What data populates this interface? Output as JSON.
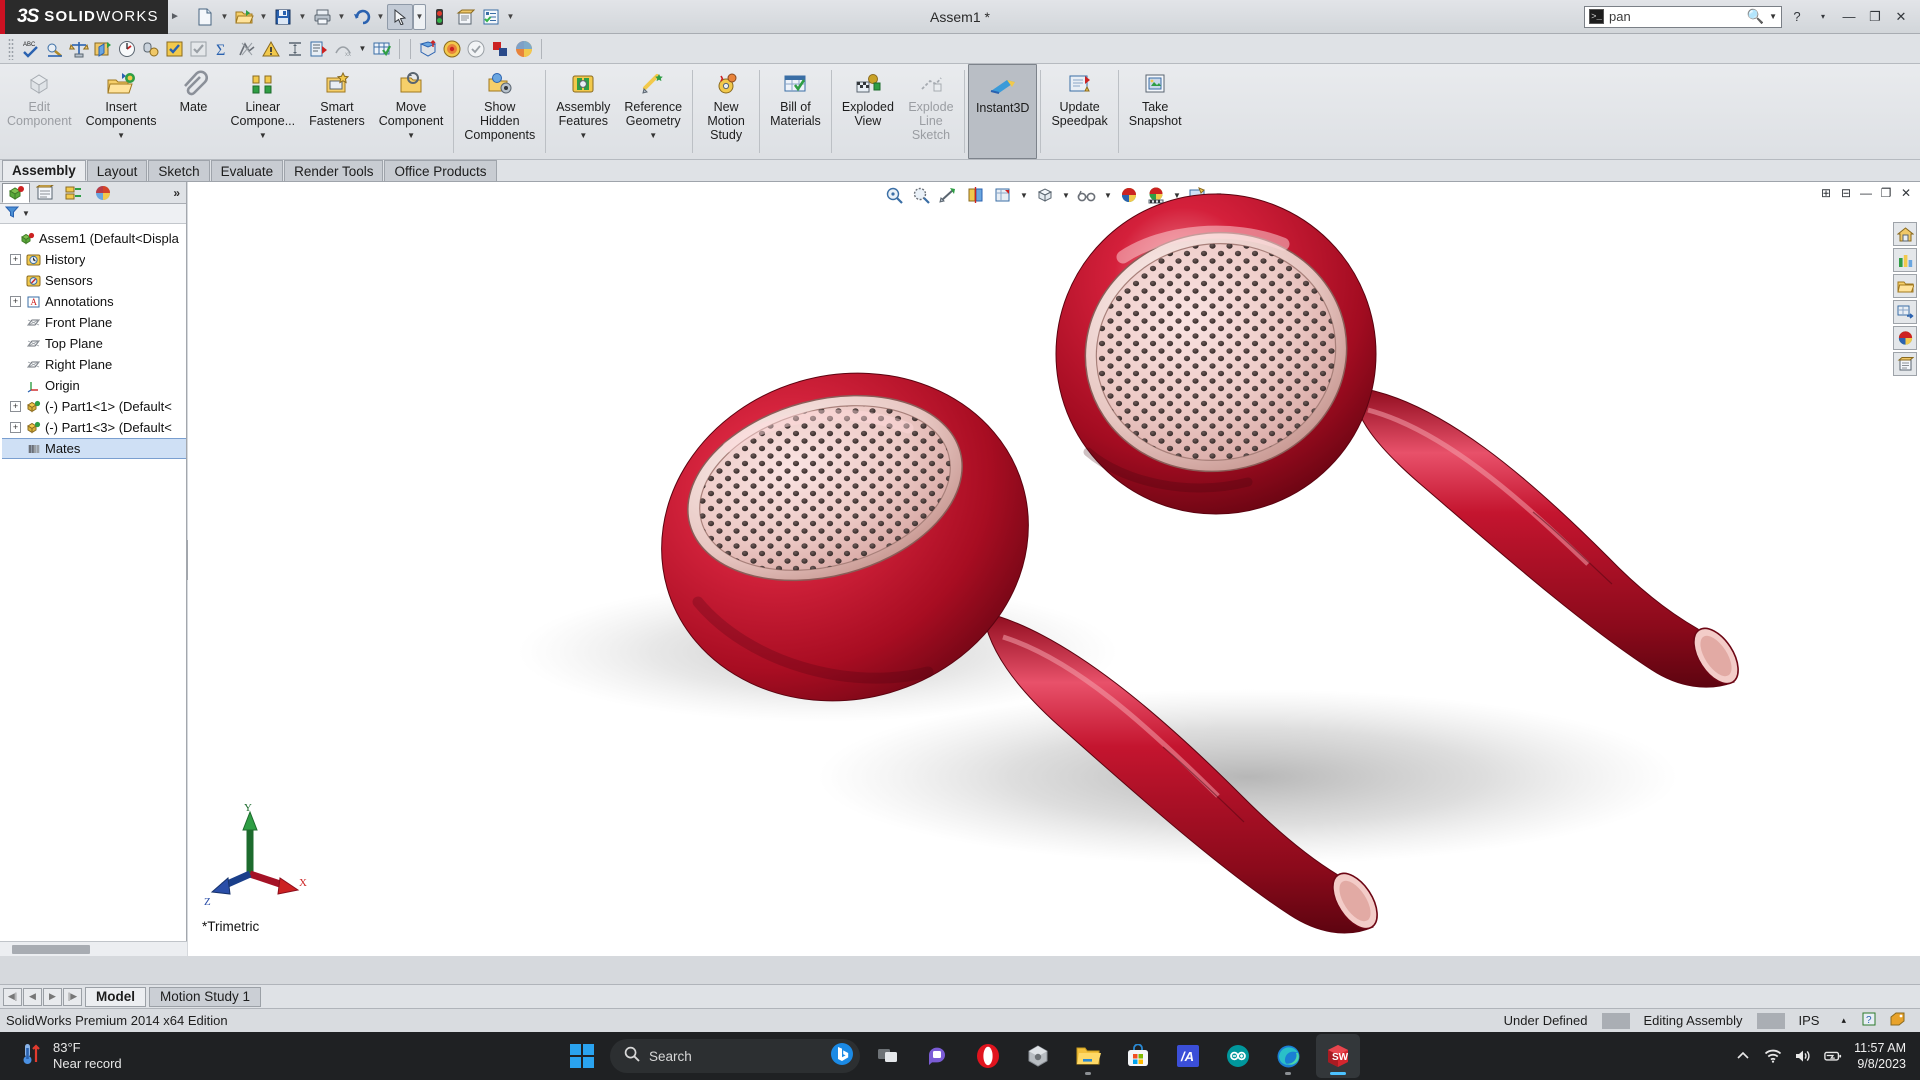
{
  "titlebar": {
    "brand_mark": "3S",
    "brand_name_bold": "SOLID",
    "brand_name_light": "WORKS",
    "document_title": "Assem1 *",
    "quick_access": [
      {
        "name": "new-document-button",
        "icon": "new-file-icon"
      },
      {
        "name": "open-document-button",
        "icon": "open-folder-icon"
      },
      {
        "name": "save-button",
        "icon": "save-disk-icon"
      },
      {
        "name": "print-button",
        "icon": "printer-icon"
      },
      {
        "name": "undo-button",
        "icon": "undo-arrow-icon"
      },
      {
        "name": "select-button",
        "icon": "cursor-arrow-icon"
      },
      {
        "name": "rebuild-button",
        "icon": "traffic-light-icon"
      },
      {
        "name": "options-button",
        "icon": "gear-document-icon"
      },
      {
        "name": "checklist-button",
        "icon": "checklist-icon"
      }
    ],
    "search": {
      "value": "pan",
      "placeholder": "Search",
      "command_icon": "command-prompt-icon",
      "magnifier_icon": "search-icon"
    },
    "window_controls": [
      {
        "name": "help-button",
        "glyph": "?"
      },
      {
        "name": "help-dropdown",
        "glyph": "▾"
      },
      {
        "name": "minimize-button",
        "glyph": "—"
      },
      {
        "name": "restore-button",
        "glyph": "❐"
      },
      {
        "name": "close-button",
        "glyph": "✕"
      }
    ]
  },
  "icon_strip": [
    {
      "name": "spell-check-icon",
      "label": "ABC"
    },
    {
      "name": "measure-icon",
      "label": ""
    },
    {
      "name": "mass-properties-icon",
      "label": ""
    },
    {
      "name": "section-properties-icon",
      "label": ""
    },
    {
      "name": "performance-evaluation-icon",
      "label": ""
    },
    {
      "name": "sensor-icon",
      "label": ""
    },
    {
      "name": "check-yellow-icon",
      "label": ""
    },
    {
      "name": "check-grey-icon",
      "label": ""
    },
    {
      "name": "sum-icon",
      "label": "Σ"
    },
    {
      "name": "geometry-analysis-icon",
      "label": ""
    },
    {
      "name": "interference-detection-icon",
      "label": ""
    },
    {
      "name": "clearance-verification-icon",
      "label": ""
    },
    {
      "name": "hole-alignment-icon",
      "label": ""
    },
    {
      "name": "curvature-icon",
      "label": ""
    },
    {
      "name": "design-table-icon",
      "label": ""
    },
    {
      "name": "simulation-icon",
      "label": ""
    },
    {
      "name": "sustainability-icon",
      "label": ""
    },
    {
      "name": "check-circle-icon",
      "label": ""
    },
    {
      "name": "appearance-icon",
      "label": ""
    },
    {
      "name": "scene-icon",
      "label": ""
    }
  ],
  "ribbon": {
    "buttons": [
      {
        "name": "edit-component-button",
        "label": "Edit\nComponent",
        "icon": "edit-component-icon",
        "disabled": true,
        "caret": false,
        "active": false
      },
      {
        "name": "insert-components-button",
        "label": "Insert\nComponents",
        "icon": "insert-components-icon",
        "disabled": false,
        "caret": true,
        "active": false
      },
      {
        "name": "mate-button",
        "label": "Mate",
        "icon": "mate-paperclip-icon",
        "disabled": false,
        "caret": false,
        "active": false
      },
      {
        "name": "linear-component-pattern-button",
        "label": "Linear\nCompone...",
        "icon": "linear-pattern-icon",
        "disabled": false,
        "caret": true,
        "active": false
      },
      {
        "name": "smart-fasteners-button",
        "label": "Smart\nFasteners",
        "icon": "smart-fasteners-icon",
        "disabled": false,
        "caret": false,
        "active": false
      },
      {
        "name": "move-component-button",
        "label": "Move\nComponent",
        "icon": "move-component-icon",
        "disabled": false,
        "caret": true,
        "active": false
      },
      {
        "name": "show-hidden-components-button",
        "label": "Show\nHidden\nComponents",
        "icon": "show-hidden-icon",
        "disabled": false,
        "caret": false,
        "active": false
      },
      {
        "name": "assembly-features-button",
        "label": "Assembly\nFeatures",
        "icon": "assembly-features-icon",
        "disabled": false,
        "caret": true,
        "active": false
      },
      {
        "name": "reference-geometry-button",
        "label": "Reference\nGeometry",
        "icon": "reference-geometry-icon",
        "disabled": false,
        "caret": true,
        "active": false
      },
      {
        "name": "new-motion-study-button",
        "label": "New\nMotion\nStudy",
        "icon": "new-motion-study-icon",
        "disabled": false,
        "caret": false,
        "active": false
      },
      {
        "name": "bill-of-materials-button",
        "label": "Bill of\nMaterials",
        "icon": "bill-of-materials-icon",
        "disabled": false,
        "caret": false,
        "active": false
      },
      {
        "name": "exploded-view-button",
        "label": "Exploded\nView",
        "icon": "exploded-view-icon",
        "disabled": false,
        "caret": false,
        "active": false
      },
      {
        "name": "explode-line-sketch-button",
        "label": "Explode\nLine\nSketch",
        "icon": "explode-line-sketch-icon",
        "disabled": true,
        "caret": false,
        "active": false
      },
      {
        "name": "instant3d-button",
        "label": "Instant3D",
        "icon": "instant3d-icon",
        "disabled": false,
        "caret": false,
        "active": true
      },
      {
        "name": "update-speedpak-button",
        "label": "Update\nSpeedpak",
        "icon": "update-speedpak-icon",
        "disabled": false,
        "caret": false,
        "active": false
      },
      {
        "name": "take-snapshot-button",
        "label": "Take\nSnapshot",
        "icon": "take-snapshot-icon",
        "disabled": false,
        "caret": false,
        "active": false
      }
    ],
    "separator_after": [
      6,
      8,
      9,
      10,
      12,
      13,
      14
    ]
  },
  "ribbon_tabs": [
    {
      "name": "tab-assembly",
      "label": "Assembly",
      "selected": true
    },
    {
      "name": "tab-layout",
      "label": "Layout",
      "selected": false
    },
    {
      "name": "tab-sketch",
      "label": "Sketch",
      "selected": false
    },
    {
      "name": "tab-evaluate",
      "label": "Evaluate",
      "selected": false
    },
    {
      "name": "tab-render-tools",
      "label": "Render Tools",
      "selected": false
    },
    {
      "name": "tab-office-products",
      "label": "Office Products",
      "selected": false
    }
  ],
  "left_panel": {
    "tabs": [
      {
        "name": "feature-manager-tab",
        "icon": "feature-tree-icon",
        "selected": true
      },
      {
        "name": "property-manager-tab",
        "icon": "property-manager-icon",
        "selected": false
      },
      {
        "name": "configuration-manager-tab",
        "icon": "configuration-manager-icon",
        "selected": false
      },
      {
        "name": "display-manager-tab",
        "icon": "display-manager-icon",
        "selected": false
      }
    ],
    "more_glyph": "»",
    "filter_placeholder": "",
    "tree": [
      {
        "name": "tree-item-assem1",
        "label": "Assem1  (Default<Displa",
        "icon": "assembly-icon",
        "expand": "none",
        "indent": 0,
        "selected": false
      },
      {
        "name": "tree-item-history",
        "label": "History",
        "icon": "history-icon",
        "expand": "+",
        "indent": 1,
        "selected": false
      },
      {
        "name": "tree-item-sensors",
        "label": "Sensors",
        "icon": "sensors-icon",
        "expand": "none",
        "indent": 1,
        "selected": false
      },
      {
        "name": "tree-item-annotations",
        "label": "Annotations",
        "icon": "annotations-icon",
        "expand": "+",
        "indent": 1,
        "selected": false
      },
      {
        "name": "tree-item-front-plane",
        "label": "Front Plane",
        "icon": "plane-icon",
        "expand": "none",
        "indent": 1,
        "selected": false
      },
      {
        "name": "tree-item-top-plane",
        "label": "Top Plane",
        "icon": "plane-icon",
        "expand": "none",
        "indent": 1,
        "selected": false
      },
      {
        "name": "tree-item-right-plane",
        "label": "Right Plane",
        "icon": "plane-icon",
        "expand": "none",
        "indent": 1,
        "selected": false
      },
      {
        "name": "tree-item-origin",
        "label": "Origin",
        "icon": "origin-icon",
        "expand": "none",
        "indent": 1,
        "selected": false
      },
      {
        "name": "tree-item-part1-1",
        "label": "(-) Part1<1>  (Default<",
        "icon": "part-icon",
        "expand": "+",
        "indent": 1,
        "selected": false
      },
      {
        "name": "tree-item-part1-3",
        "label": "(-) Part1<3>  (Default<",
        "icon": "part-icon",
        "expand": "+",
        "indent": 1,
        "selected": false
      },
      {
        "name": "tree-item-mates",
        "label": "Mates",
        "icon": "mates-icon",
        "expand": "none",
        "indent": 1,
        "selected": true
      }
    ]
  },
  "viewport": {
    "view_toolbar": [
      {
        "name": "zoom-to-fit-button",
        "icon": "zoom-fit-icon",
        "caret": false
      },
      {
        "name": "zoom-to-area-button",
        "icon": "zoom-area-icon",
        "caret": false
      },
      {
        "name": "previous-view-button",
        "icon": "previous-view-icon",
        "caret": false
      },
      {
        "name": "section-view-button",
        "icon": "section-view-icon",
        "caret": false
      },
      {
        "name": "view-orientation-button",
        "icon": "view-orientation-icon",
        "caret": true
      },
      {
        "name": "display-style-button",
        "icon": "display-style-cube-icon",
        "caret": true
      },
      {
        "name": "hide-show-items-button",
        "icon": "glasses-icon",
        "caret": true
      },
      {
        "name": "edit-appearance-button",
        "icon": "appearance-sphere-icon",
        "caret": false
      },
      {
        "name": "apply-scene-button",
        "icon": "scene-icon",
        "caret": true
      },
      {
        "name": "view-settings-button",
        "icon": "view-settings-icon",
        "caret": true
      }
    ],
    "corner_buttons": [
      {
        "name": "viewport-tile-button",
        "glyph": "⊞"
      },
      {
        "name": "viewport-split-button",
        "glyph": "⊟"
      },
      {
        "name": "doc-minimize-button",
        "glyph": "—"
      },
      {
        "name": "doc-restore-button",
        "glyph": "❐"
      },
      {
        "name": "doc-close-button",
        "glyph": "✕"
      }
    ],
    "task_pane": [
      {
        "name": "solidworks-resources-button",
        "icon": "home-icon"
      },
      {
        "name": "design-library-button",
        "icon": "library-icon"
      },
      {
        "name": "file-explorer-button",
        "icon": "folder-icon"
      },
      {
        "name": "view-palette-button",
        "icon": "view-palette-icon"
      },
      {
        "name": "appearances-scenes-button",
        "icon": "appearance-sphere-icon"
      },
      {
        "name": "custom-properties-button",
        "icon": "custom-properties-icon"
      }
    ],
    "triad": {
      "x_label": "X",
      "y_label": "Y",
      "z_label": "Z"
    },
    "view_label": "*Trimetric",
    "model_description": "Two red whistle-shaped assembly components with perforated pink mesh faces"
  },
  "bottom_tabs": {
    "nav_buttons": [
      {
        "name": "first-tab-button",
        "glyph": "◀|"
      },
      {
        "name": "previous-tab-button",
        "glyph": "◀"
      },
      {
        "name": "next-tab-button",
        "glyph": "▶"
      },
      {
        "name": "last-tab-button",
        "glyph": "|▶"
      }
    ],
    "tabs": [
      {
        "name": "bottom-tab-model",
        "label": "Model",
        "selected": true
      },
      {
        "name": "bottom-tab-motion-study-1",
        "label": "Motion Study 1",
        "selected": false
      }
    ]
  },
  "statusbar": {
    "edition": "SolidWorks Premium 2014 x64 Edition",
    "items": [
      {
        "name": "status-under-defined",
        "label": "Under Defined"
      },
      {
        "name": "status-editing-assembly",
        "label": "Editing Assembly"
      },
      {
        "name": "status-units",
        "label": "IPS"
      },
      {
        "name": "status-units-caret",
        "label": "▴"
      },
      {
        "name": "status-help-icon",
        "label": "?"
      },
      {
        "name": "status-tag-icon",
        "label": ""
      }
    ]
  },
  "taskbar": {
    "weather": {
      "temperature": "83°F",
      "condition": "Near record",
      "icon": "thermometer-icon"
    },
    "start_label": "Start",
    "search": {
      "placeholder": "Search",
      "copilot_icon": "bing-chat-icon",
      "icon": "search-icon"
    },
    "apps": [
      {
        "name": "taskview-button",
        "icon": "task-view-icon",
        "running": false,
        "active": false
      },
      {
        "name": "chat-button",
        "icon": "chat-icon",
        "running": false,
        "active": false
      },
      {
        "name": "opera-button",
        "icon": "opera-icon",
        "running": false,
        "active": false
      },
      {
        "name": "onshape-button",
        "icon": "onshape-icon",
        "running": false,
        "active": false
      },
      {
        "name": "file-explorer-button",
        "icon": "file-explorer-icon",
        "running": true,
        "active": false
      },
      {
        "name": "microsoft-store-button",
        "icon": "microsoft-store-icon",
        "running": false,
        "active": false
      },
      {
        "name": "matlab-button",
        "icon": "matlab-icon",
        "running": false,
        "active": false
      },
      {
        "name": "arduino-button",
        "icon": "arduino-icon",
        "running": false,
        "active": false
      },
      {
        "name": "edge-button",
        "icon": "edge-icon",
        "running": true,
        "active": false
      },
      {
        "name": "solidworks-button",
        "icon": "solidworks-icon",
        "running": true,
        "active": true
      }
    ],
    "tray": [
      {
        "name": "show-hidden-icons-button",
        "icon": "chevron-up-icon"
      },
      {
        "name": "network-button",
        "icon": "wifi-icon"
      },
      {
        "name": "volume-button",
        "icon": "speaker-icon"
      },
      {
        "name": "battery-button",
        "icon": "battery-icon"
      }
    ],
    "clock": {
      "time": "11:57 AM",
      "date": "9/8/2023"
    }
  },
  "colors": {
    "brand_red": "#cc1122",
    "model_red": "#c41230",
    "accent_blue": "#4cc2ff",
    "selection_blue": "#cfe0f5"
  }
}
